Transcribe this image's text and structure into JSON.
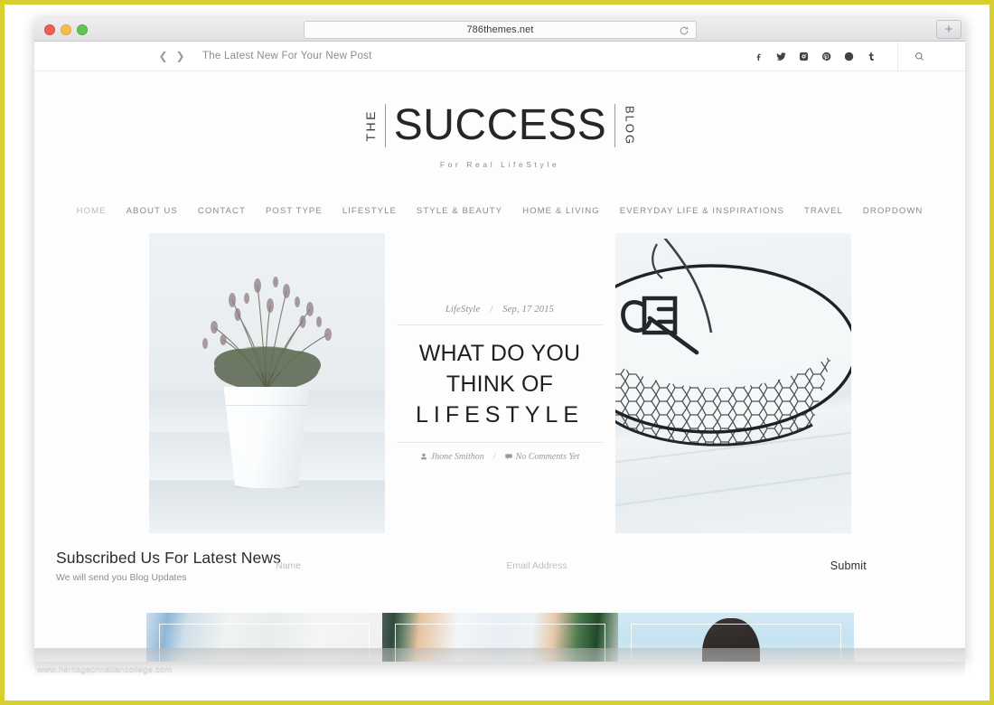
{
  "browser": {
    "url": "786themes.net",
    "reload_icon": "reload-icon",
    "newtab_label": "+",
    "traffic_lights": [
      "close",
      "minimize",
      "zoom"
    ]
  },
  "topbar": {
    "prev_icon": "chevron-left-icon",
    "next_icon": "chevron-right-icon",
    "ticker_text": "The Latest New For Your New Post",
    "social": [
      {
        "name": "facebook-icon",
        "label": "f"
      },
      {
        "name": "twitter-icon",
        "label": "t"
      },
      {
        "name": "instagram-icon",
        "label": "ig"
      },
      {
        "name": "pinterest-icon",
        "label": "p"
      },
      {
        "name": "dribbble-icon",
        "label": "d"
      },
      {
        "name": "tumblr-icon",
        "label": "t"
      }
    ],
    "search_icon": "search-icon"
  },
  "logo": {
    "prefix": "THE",
    "main": "SUCCESS",
    "suffix": "BLOG",
    "tagline": "For Real LifeStyle"
  },
  "nav": {
    "items": [
      {
        "label": "HOME",
        "active": true
      },
      {
        "label": "ABOUT US",
        "active": false
      },
      {
        "label": "CONTACT",
        "active": false
      },
      {
        "label": "POST TYPE",
        "active": false
      },
      {
        "label": "LIFESTYLE",
        "active": false
      },
      {
        "label": "STYLE & BEAUTY",
        "active": false
      },
      {
        "label": "HOME & LIVING",
        "active": false
      },
      {
        "label": "EVERYDAY LIFE & INSPIRATIONS",
        "active": false
      },
      {
        "label": "TRAVEL",
        "active": false
      },
      {
        "label": "DROPDOWN",
        "active": false
      }
    ]
  },
  "hero": {
    "left_image_alt": "heather plant in white pot on white wooden table",
    "right_image_alt": "black wire mesh basket with antique key on white planks",
    "post": {
      "category": "LifeStyle",
      "separator": "/",
      "date": "Sep, 17 2015",
      "title_line1": "WHAT DO YOU",
      "title_line2": "THINK OF",
      "title_line3": "LIFESTYLE",
      "author": "Jhone Smithon",
      "comments": "No Comments Yet",
      "author_icon": "user-icon",
      "comment_icon": "comment-icon"
    }
  },
  "subscribe": {
    "title": "Subscribed Us For Latest News",
    "subtitle": "We will send you Blog Updates",
    "name_placeholder": "Name",
    "email_placeholder": "Email Address",
    "name_value": "",
    "email_value": "",
    "submit_label": "Submit"
  },
  "bottom_posts": [
    {
      "alt": "person in blue jeans and white pleated fabric"
    },
    {
      "alt": "white lace dress detail with green background"
    },
    {
      "alt": "woman with dark hair facing away against pale blue sky"
    }
  ],
  "watermark": {
    "text": "www.heritagechristiancollege.com"
  },
  "colors": {
    "page_border": "#d8cf2e",
    "logo_dark": "#262626",
    "nav_text": "#8a8a8a",
    "muted": "#8e8e8e"
  }
}
